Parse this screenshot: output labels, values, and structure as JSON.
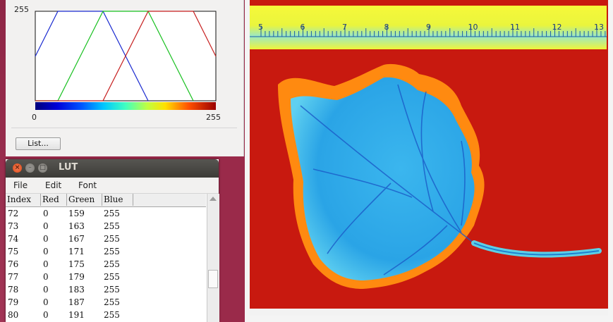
{
  "lut_plot": {
    "y_max_label": "255",
    "x_min_label": "0",
    "x_max_label": "255",
    "list_button": "List..."
  },
  "lut_window": {
    "title": "LUT",
    "menu": [
      "File",
      "Edit",
      "Font"
    ],
    "columns": [
      "Index",
      "Red",
      "Green",
      "Blue"
    ],
    "rows": [
      [
        "72",
        "0",
        "159",
        "255"
      ],
      [
        "73",
        "0",
        "163",
        "255"
      ],
      [
        "74",
        "0",
        "167",
        "255"
      ],
      [
        "75",
        "0",
        "171",
        "255"
      ],
      [
        "76",
        "0",
        "175",
        "255"
      ],
      [
        "77",
        "0",
        "179",
        "255"
      ],
      [
        "78",
        "0",
        "183",
        "255"
      ],
      [
        "79",
        "0",
        "187",
        "255"
      ],
      [
        "80",
        "0",
        "191",
        "255"
      ]
    ]
  },
  "image_window": {
    "ruler_labels": [
      "5",
      "6",
      "7",
      "8",
      "9",
      "10",
      "11",
      "12",
      "13"
    ]
  },
  "colors": {
    "background_red": "#c8190f",
    "ruler_yellow": "#f3f536",
    "ruler_cyan": "#86e4d8",
    "leaf_blue": "#1f9ee6",
    "leaf_cyan": "#47c8f0",
    "desktop": "#9a2a4a"
  }
}
